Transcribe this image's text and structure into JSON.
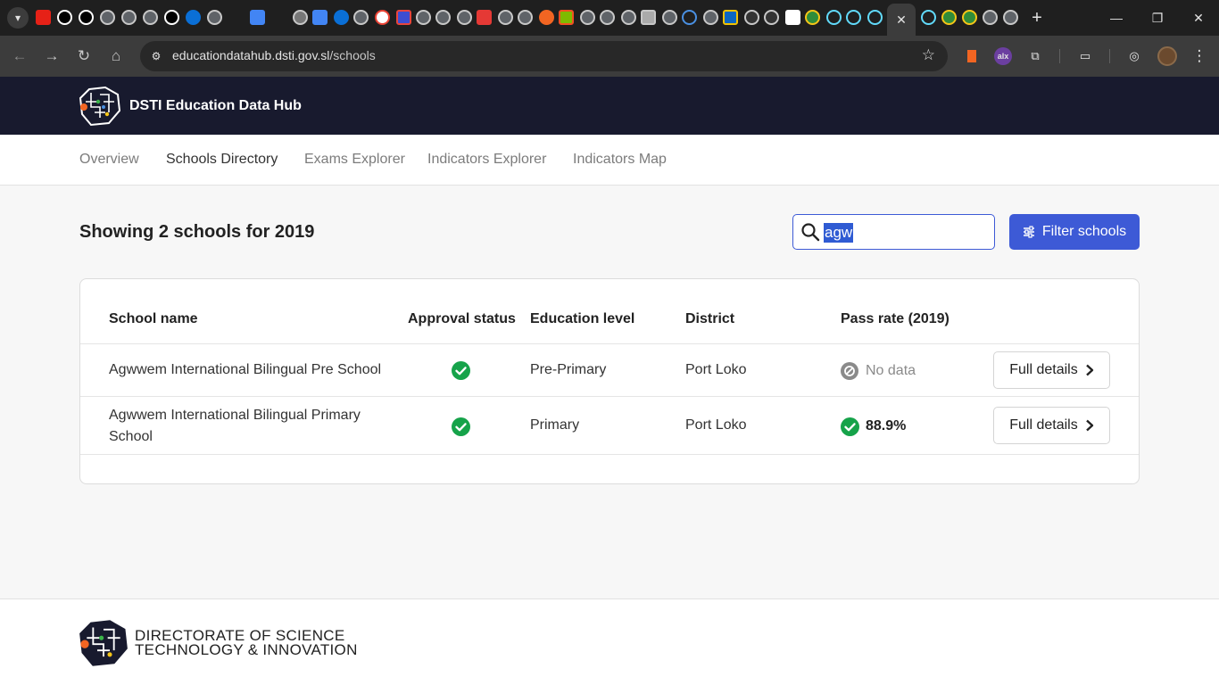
{
  "browser": {
    "url_host": "educationdatahub.dsti.gov.sl",
    "url_path": "/schools",
    "ext_alx_label": "alx"
  },
  "site": {
    "brand": "DSTI Education Data Hub",
    "nav": [
      "Overview",
      "Schools Directory",
      "Exams Explorer",
      "Indicators Explorer",
      "Indicators Map"
    ],
    "active_nav": "Schools Directory"
  },
  "main": {
    "heading": "Showing 2 schools for 2019",
    "search_value": "agw",
    "filter_label": "Filter schools"
  },
  "table": {
    "headers": [
      "School name",
      "Approval status",
      "Education level",
      "District",
      "Pass rate (2019)"
    ],
    "rows": [
      {
        "name": "Agwwem International Bilingual Pre School",
        "approved": true,
        "level": "Pre-Primary",
        "district": "Port Loko",
        "pass_rate": "No data",
        "details": "Full details"
      },
      {
        "name": "Agwwem International Bilingual Primary School",
        "approved": true,
        "level": "Primary",
        "district": "Port Loko",
        "pass_rate": "88.9%",
        "details": "Full details"
      }
    ]
  },
  "footer": {
    "line1": "DIRECTORATE OF SCIENCE",
    "line2": "TECHNOLOGY & INNOVATION"
  },
  "colors": {
    "header_bg": "#181a2e",
    "accent": "#3d5ad6",
    "success": "#16a34a",
    "muted": "#7c7c7c"
  }
}
